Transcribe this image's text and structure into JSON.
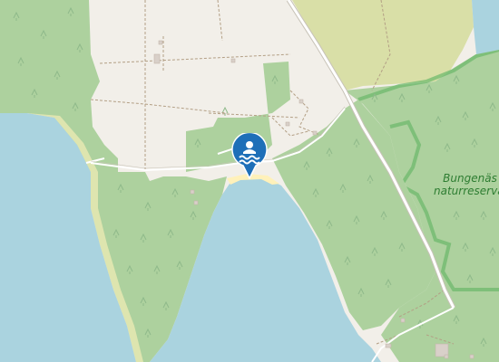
{
  "map": {
    "colors": {
      "water": "#aad3df",
      "land": "#f2efe9",
      "forest": "#add19e",
      "farmland": "#d9dfa7",
      "reserve_border": "#6ab86a",
      "road": "#ffffff",
      "road_casing": "#c8c3b8",
      "track": "#b39f85",
      "beach": "#fff1ba",
      "marker": "#1e6fb8"
    },
    "labels": {
      "reserve_line1": "Bungenäs",
      "reserve_line2": "naturreservat"
    },
    "icons": {
      "marker": "swimming-marker-icon",
      "tree": "tree-icon"
    }
  }
}
